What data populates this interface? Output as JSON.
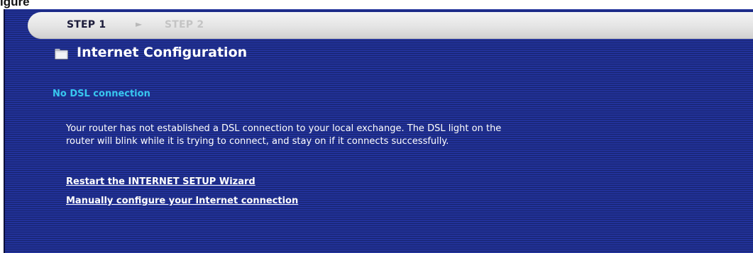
{
  "caption": {
    "text": "igure"
  },
  "steps": {
    "current_label": "STEP 1",
    "arrow": "►",
    "next_label": "STEP 2"
  },
  "header": {
    "title": "Internet Configuration",
    "icon": "folder-icon"
  },
  "status": {
    "text": "No DSL connection",
    "color": "#38c7ef"
  },
  "description": {
    "line1": "Your router has not established a DSL connection to your local exchange. The DSL light on the",
    "line2": "router will blink while it is trying to connect, and stay on if it connects successfully."
  },
  "links": {
    "restart_wizard": "Restart the INTERNET SETUP Wizard",
    "manual_config": "Manually configure your Internet connection"
  },
  "colors": {
    "panel": "#1d2c85",
    "step_bar": "#e4e4e4"
  }
}
